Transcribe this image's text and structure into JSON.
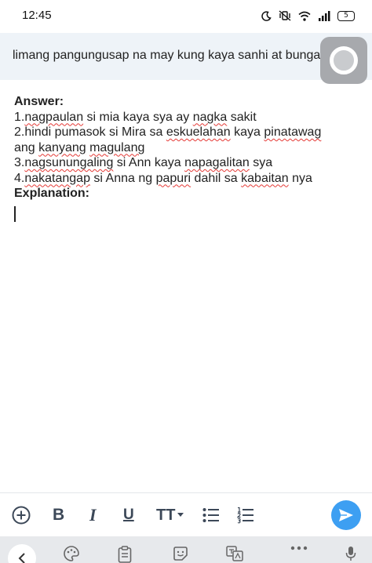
{
  "status_bar": {
    "time": "12:45",
    "battery": "5",
    "icons": [
      "moon-icon",
      "mute-vibrate-icon",
      "wifi-icon",
      "signal-icon",
      "battery-icon"
    ]
  },
  "question": {
    "text": "limang pangungusap na may kung kaya sanhi at bunga"
  },
  "answer": {
    "heading": "Answer:",
    "lines": [
      [
        {
          "t": "1."
        },
        {
          "t": "nagpaulan",
          "misspelled": true
        },
        {
          "t": " si mia kaya sya ay "
        },
        {
          "t": "nagka",
          "misspelled": true
        },
        {
          "t": " sakit"
        }
      ],
      [
        {
          "t": "2.hindi pumasok si Mira sa "
        },
        {
          "t": "eskuelahan",
          "misspelled": true
        },
        {
          "t": " kaya "
        },
        {
          "t": "pinatawag",
          "misspelled": true
        }
      ],
      [
        {
          "t": "ang "
        },
        {
          "t": "kanyang",
          "misspelled": true
        },
        {
          "t": " "
        },
        {
          "t": "magulang",
          "misspelled": true
        }
      ],
      [
        {
          "t": "3."
        },
        {
          "t": "nagsunungaling",
          "misspelled": true
        },
        {
          "t": " si Ann kaya "
        },
        {
          "t": "napagalitan",
          "misspelled": true
        },
        {
          "t": " sya"
        }
      ],
      [
        {
          "t": "4."
        },
        {
          "t": "nakatangap",
          "misspelled": true
        },
        {
          "t": " si Anna ng "
        },
        {
          "t": "papuri",
          "misspelled": true
        },
        {
          "t": " dahil sa "
        },
        {
          "t": "kabaitan",
          "misspelled": true
        },
        {
          "t": " nya"
        }
      ]
    ],
    "explanation_heading": "Explanation:"
  },
  "toolbar": {
    "bold_label": "B",
    "italic_label": "I",
    "underline_label": "U",
    "text_size_label": "TT",
    "icons": [
      "add-circle-icon",
      "bullet-list-icon",
      "numbered-list-icon",
      "send-icon"
    ]
  },
  "keyboard_bar": {
    "icons": [
      "chevron-left-icon",
      "palette-icon",
      "clipboard-icon",
      "sticker-icon",
      "translate-icon",
      "more-icon",
      "microphone-icon"
    ]
  },
  "colors": {
    "accent": "#3d9ff2",
    "spellcheck_underline": "#e53935",
    "question_background": "#eef3f8",
    "icon": "#3c4858"
  }
}
